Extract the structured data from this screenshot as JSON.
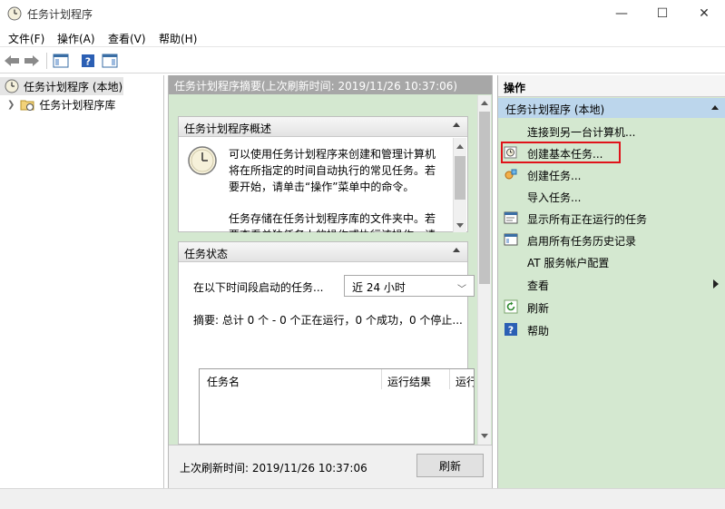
{
  "window": {
    "title": "任务计划程序"
  },
  "menu": [
    "文件(F)",
    "操作(A)",
    "查看(V)",
    "帮助(H)"
  ],
  "tree": {
    "root": "任务计划程序 (本地)",
    "child": "任务计划程序库"
  },
  "center": {
    "header": "任务计划程序摘要(上次刷新时间: 2019/11/26 10:37:06)",
    "overview": {
      "title": "任务计划程序概述",
      "lines": [
        "可以使用任务计划程序来创建和管理计算机",
        "将在所指定的时间自动执行的常见任务。若",
        "要开始，请单击“操作”菜单中的命令。",
        "",
        "任务存储在任务计划程序库的文件夹中。若",
        "要查看单独任务上的操作或执行该操作，请"
      ]
    },
    "status": {
      "title": "任务状态",
      "range_label": "在以下时间段启动的任务...",
      "range_value": "近 24 小时",
      "summary": "摘要: 总计 0 个 - 0 个正在运行，0 个成功，0 个停止...",
      "columns": [
        "任务名",
        "运行结果",
        "运行"
      ]
    },
    "footer": {
      "last_refresh": "上次刷新时间: 2019/11/26 10:37:06",
      "refresh_button": "刷新"
    }
  },
  "actions": {
    "title": "操作",
    "section": "任务计划程序 (本地)",
    "items": [
      {
        "label": "连接到另一台计算机...",
        "icon": "none"
      },
      {
        "label": "创建基本任务...",
        "icon": "create-basic-task-icon"
      },
      {
        "label": "创建任务...",
        "icon": "create-task-icon"
      },
      {
        "label": "导入任务...",
        "icon": "none"
      },
      {
        "label": "显示所有正在运行的任务",
        "icon": "running-tasks-icon"
      },
      {
        "label": "启用所有任务历史记录",
        "icon": "history-icon"
      },
      {
        "label": "AT 服务帐户配置",
        "icon": "none"
      },
      {
        "label": "查看",
        "icon": "none"
      },
      {
        "label": "刷新",
        "icon": "refresh-icon"
      },
      {
        "label": "帮助",
        "icon": "help-icon"
      }
    ]
  },
  "colors": {
    "pane_green": "#d4e8d0",
    "section_blue": "#bcd6ec",
    "highlight_red": "#e0131a"
  }
}
